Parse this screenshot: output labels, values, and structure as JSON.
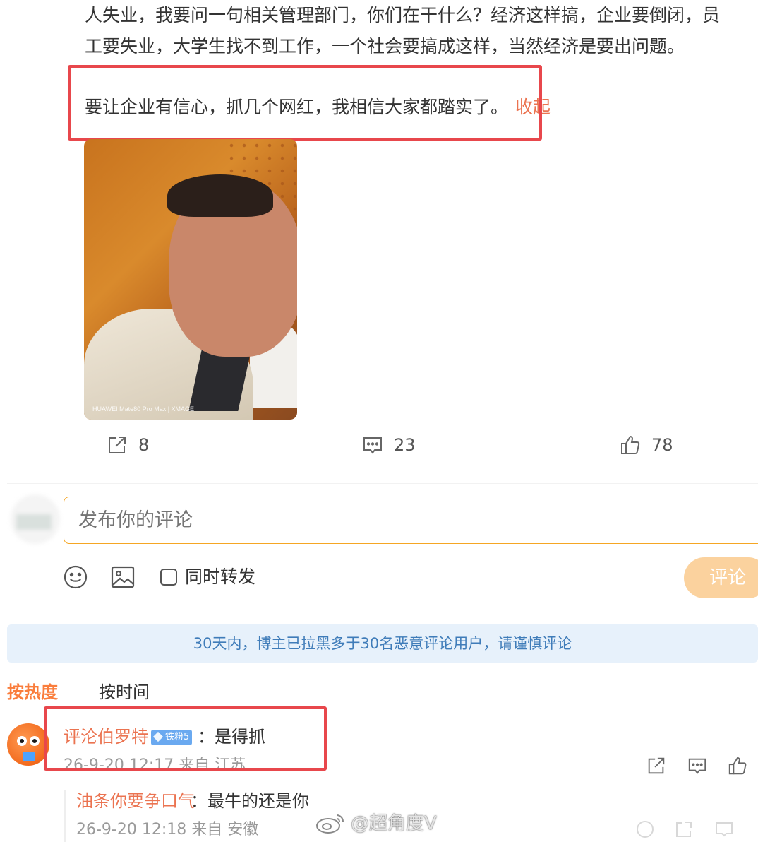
{
  "post": {
    "line1": "人失业，我要问一句相关管理部门，你们在干什么？经济这样搞，企业要倒闭，员",
    "line2": "工要失业，大学生找不到工作，一个社会要搞成这样，当然经济是要出问题。",
    "line3": "要让企业有信心，抓几个网红，我相信大家都踏实了。",
    "collapse_label": "收起",
    "photo_watermark": "HUAWEI Mate80 Pro Max | XMAGE"
  },
  "actions": {
    "share_count": "8",
    "comment_count": "23",
    "like_count": "78"
  },
  "composer": {
    "placeholder": "发布你的评论",
    "repost_label": "同时转发",
    "submit_label": "评论"
  },
  "notice": "30天内，博主已拉黑多于30名恶意评论用户，请谨慎评论",
  "sort_tabs": {
    "hot": "按热度",
    "time": "按时间"
  },
  "comment": {
    "author": "评沦伯罗特",
    "fan_badge": "铁粉5",
    "text": "：是得抓",
    "meta": "26-9-20 12:17 来自 江苏"
  },
  "reply": {
    "author": "油条你要争口气",
    "text": "：最牛的还是你",
    "meta": "26-9-20 12:18 来自 安徽"
  },
  "watermark": "@超角度V"
}
